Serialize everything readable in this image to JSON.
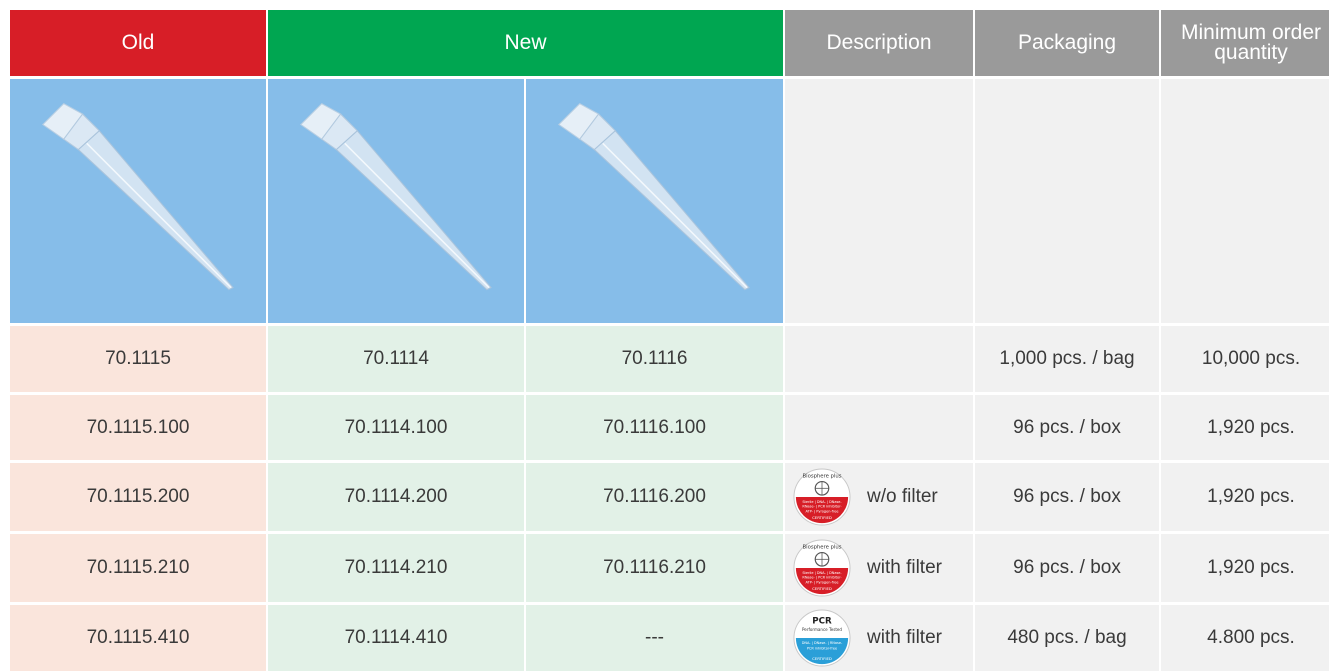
{
  "headers": {
    "old": "Old",
    "new": "New",
    "description": "Description",
    "packaging": "Packaging",
    "min_order": "Minimum order quantity"
  },
  "rows": [
    {
      "old": "70.1115",
      "new1": "70.1114",
      "new2": "70.1116",
      "description": "",
      "seal": "none",
      "packaging": "1,000 pcs. / bag",
      "min_order": "10,000 pcs."
    },
    {
      "old": "70.1115.100",
      "new1": "70.1114.100",
      "new2": "70.1116.100",
      "description": "",
      "seal": "none",
      "packaging": "96 pcs. / box",
      "min_order": "1,920 pcs."
    },
    {
      "old": "70.1115.200",
      "new1": "70.1114.200",
      "new2": "70.1116.200",
      "description": "w/o filter",
      "seal": "biosphere",
      "packaging": "96 pcs. / box",
      "min_order": "1,920 pcs."
    },
    {
      "old": "70.1115.210",
      "new1": "70.1114.210",
      "new2": "70.1116.210",
      "description": "with filter",
      "seal": "biosphere",
      "packaging": "96 pcs. / box",
      "min_order": "1,920 pcs."
    },
    {
      "old": "70.1115.410",
      "new1": "70.1114.410",
      "new2": "---",
      "description": "with filter",
      "seal": "pcr",
      "packaging": "480 pcs. / bag",
      "min_order": "4.800 pcs."
    }
  ],
  "seals": {
    "biosphere": {
      "top": "Biosphere plus",
      "lines": [
        "Sterile | DNA- | DNase-",
        "RNase- | PCR inhibitor-",
        "ATP- | Pyrogen-free"
      ],
      "bottom": "CERTIFIED"
    },
    "pcr": {
      "top": "PCR",
      "sub": "Performance Tested",
      "lines": [
        "DNA- | DNase- | RNase-",
        "PCR inhibitor-free"
      ],
      "bottom": "CERTIFIED"
    }
  },
  "colors": {
    "old": "#d71e27",
    "new": "#00a651",
    "header_gray": "#9a9a9a",
    "image_bg": "#86bde9"
  }
}
